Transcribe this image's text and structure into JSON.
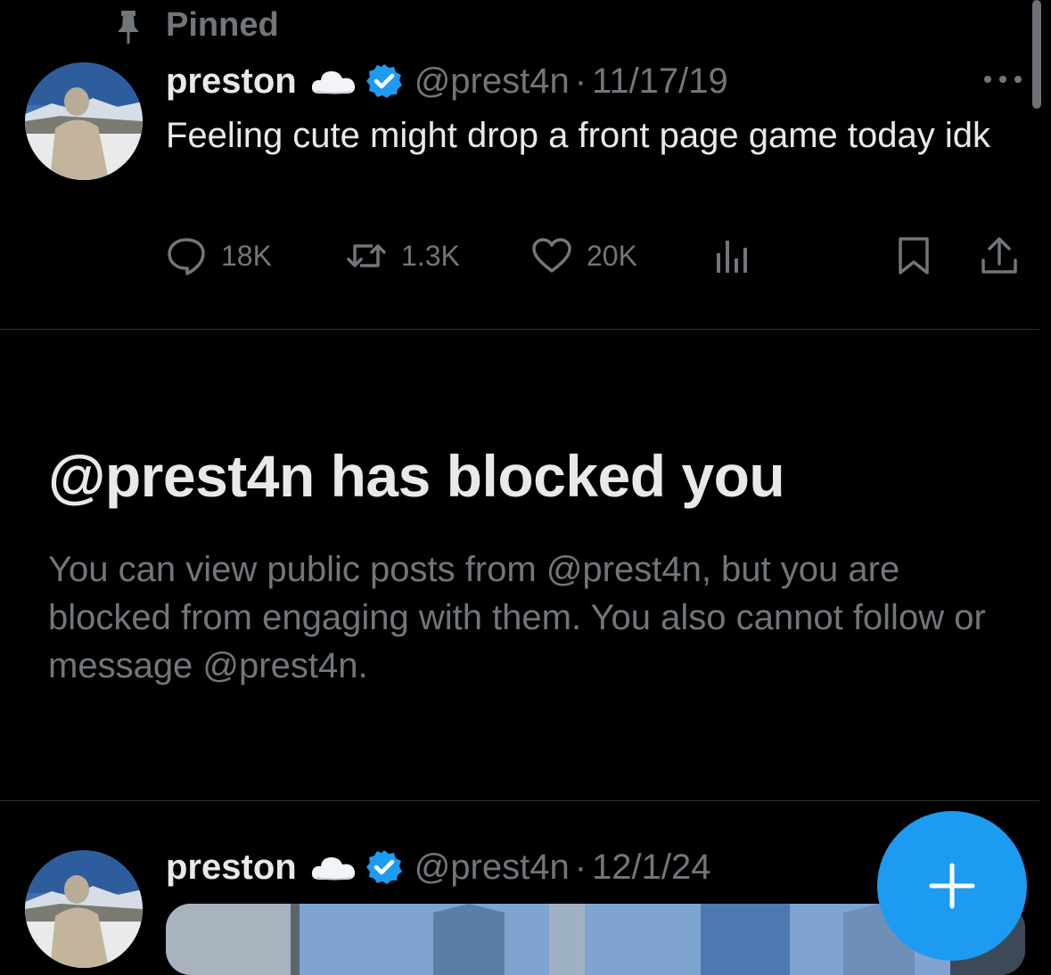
{
  "pinned": {
    "label": "Pinned",
    "icon": "pin-icon"
  },
  "pinned_tweet": {
    "display_name": "preston",
    "name_emoji": "cloud-icon",
    "verified": "verified-badge-icon",
    "handle": "@prest4n",
    "separator": "·",
    "date": "11/17/19",
    "text": "Feeling cute might drop a front page game today idk",
    "actions": {
      "replies": "18K",
      "reposts": "1.3K",
      "likes": "20K"
    }
  },
  "blocked_notice": {
    "title": "@prest4n has blocked you",
    "body": "You can view public posts from @prest4n, but you are blocked from engaging with them. You also cannot follow or message @prest4n."
  },
  "second_tweet": {
    "display_name": "preston",
    "name_emoji": "cloud-icon",
    "verified": "verified-badge-icon",
    "handle": "@prest4n",
    "separator": "·",
    "date": "12/1/24"
  },
  "compose_button": {
    "icon": "plus-icon"
  },
  "colors": {
    "background": "#000000",
    "primary_text": "#e7e9ea",
    "secondary_text": "#71767b",
    "accent": "#1d9bf0",
    "divider": "#2f3336"
  }
}
